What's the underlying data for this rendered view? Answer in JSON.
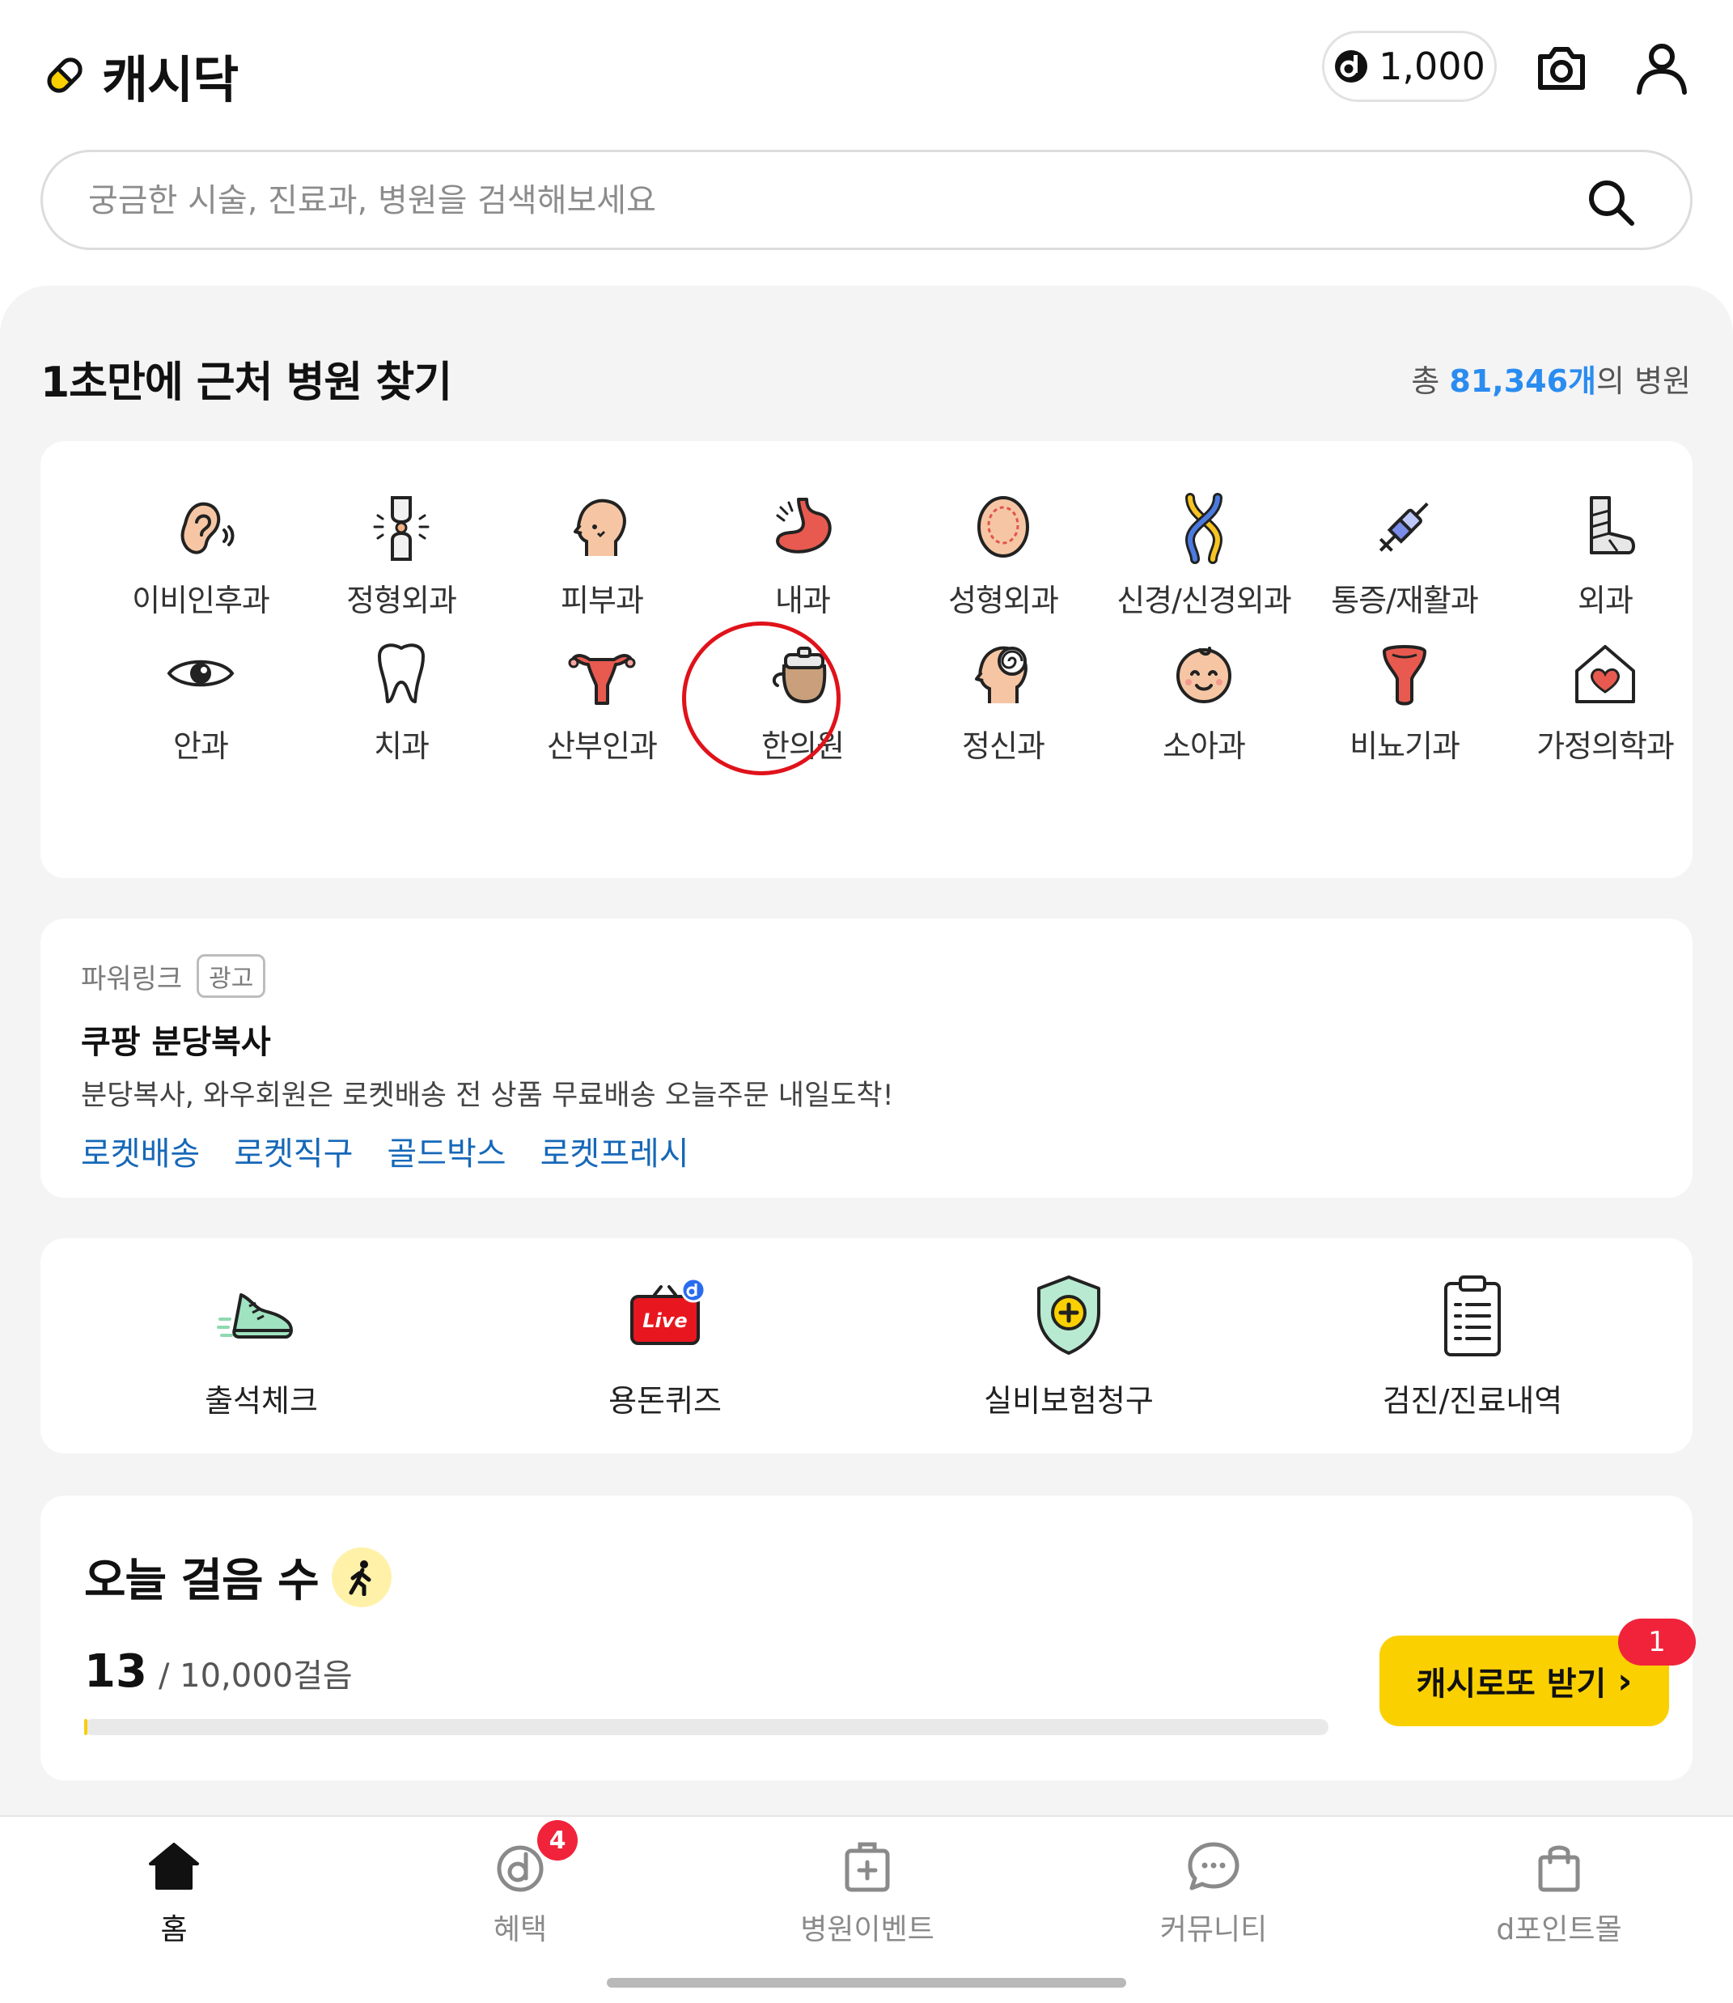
{
  "header": {
    "app_name": "캐시닥",
    "point_balance": "1,000",
    "icons": [
      "camera-icon",
      "profile-icon"
    ]
  },
  "search": {
    "placeholder": "궁금한 시술, 진료과, 병원을 검색해보세요"
  },
  "find_hospital": {
    "title": "1초만에 근처 병원 찾기",
    "total_prefix": "총 ",
    "total_count": "81,346개",
    "total_suffix": "의 병원",
    "categories": [
      {
        "label": "이비인후과",
        "icon": "ear-icon"
      },
      {
        "label": "정형외과",
        "icon": "joint-icon"
      },
      {
        "label": "피부과",
        "icon": "face-skin-icon"
      },
      {
        "label": "내과",
        "icon": "stomach-icon"
      },
      {
        "label": "성형외과",
        "icon": "head-outline-icon"
      },
      {
        "label": "신경/신경외과",
        "icon": "dna-icon"
      },
      {
        "label": "통증/재활과",
        "icon": "syringe-icon"
      },
      {
        "label": "외과",
        "icon": "cast-leg-icon"
      },
      {
        "label": "안과",
        "icon": "eye-icon"
      },
      {
        "label": "치과",
        "icon": "tooth-icon"
      },
      {
        "label": "산부인과",
        "icon": "uterus-icon"
      },
      {
        "label": "한의원",
        "icon": "herbal-pot-icon",
        "highlighted": true
      },
      {
        "label": "정신과",
        "icon": "mind-icon"
      },
      {
        "label": "소아과",
        "icon": "baby-icon"
      },
      {
        "label": "비뇨기과",
        "icon": "urology-icon"
      },
      {
        "label": "가정의학과",
        "icon": "home-heart-icon"
      }
    ],
    "highlight_color": "#e0121a"
  },
  "ad": {
    "source": "파워링크",
    "badge": "광고",
    "title": "쿠팡 분당복사",
    "description": "분당복사, 와우회원은 로켓배송 전 상품 무료배송 오늘주문 내일도착!",
    "links": [
      "로켓배송",
      "로켓직구",
      "골드박스",
      "로켓프레시"
    ]
  },
  "shortcuts": [
    {
      "label": "출석체크",
      "icon": "sneaker-icon"
    },
    {
      "label": "용돈퀴즈",
      "icon": "live-tv-icon"
    },
    {
      "label": "실비보험청구",
      "icon": "shield-plus-icon"
    },
    {
      "label": "검진/진료내역",
      "icon": "clipboard-icon"
    }
  ],
  "steps": {
    "title": "오늘 걸음 수",
    "count": "13",
    "goal": "/ 10,000걸음",
    "progress": 0.0013,
    "lotto_button": "캐시로또 받기",
    "lotto_badge": "1"
  },
  "bottom_nav": {
    "tabs": [
      {
        "label": "홈",
        "icon": "home-icon",
        "active": true
      },
      {
        "label": "혜택",
        "icon": "benefit-icon"
      },
      {
        "label": "병원이벤트",
        "icon": "medkit-icon"
      },
      {
        "label": "커뮤니티",
        "icon": "chat-icon"
      },
      {
        "label": "d포인트몰",
        "icon": "shopping-bag-icon"
      }
    ],
    "benefit_badge": "4"
  },
  "colors": {
    "accent_yellow": "#fbd000",
    "link_blue": "#1668b8",
    "count_blue": "#2a8cf0",
    "badge_red": "#f0233a"
  }
}
